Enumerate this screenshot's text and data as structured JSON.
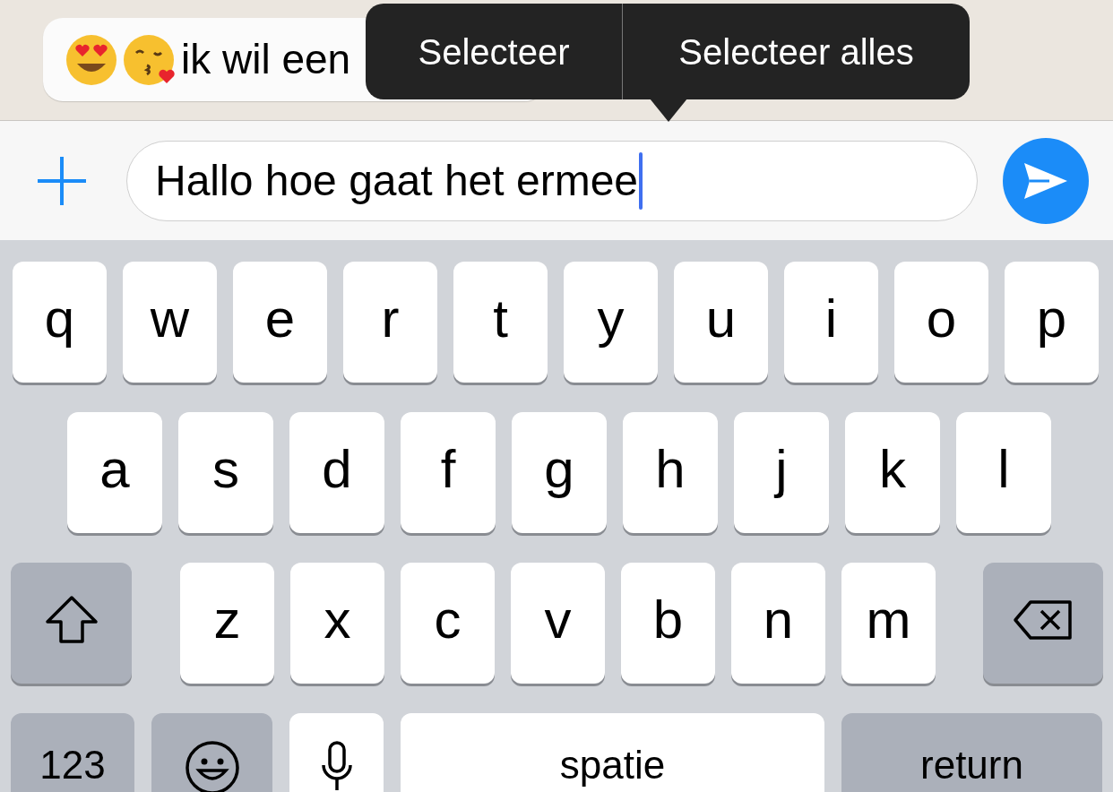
{
  "chat": {
    "bubble": {
      "text": "ik wil een"
    }
  },
  "context_menu": {
    "items": [
      {
        "label": "Selecteer"
      },
      {
        "label": "Selecteer alles"
      }
    ]
  },
  "composer": {
    "value": "Hallo hoe gaat het ermee"
  },
  "keyboard": {
    "rows": [
      [
        {
          "kind": "letter",
          "label": "q"
        },
        {
          "kind": "letter",
          "label": "w"
        },
        {
          "kind": "letter",
          "label": "e"
        },
        {
          "kind": "letter",
          "label": "r"
        },
        {
          "kind": "letter",
          "label": "t"
        },
        {
          "kind": "letter",
          "label": "y"
        },
        {
          "kind": "letter",
          "label": "u"
        },
        {
          "kind": "letter",
          "label": "i"
        },
        {
          "kind": "letter",
          "label": "o"
        },
        {
          "kind": "letter",
          "label": "p"
        }
      ],
      [
        {
          "kind": "letter",
          "label": "a"
        },
        {
          "kind": "letter",
          "label": "s"
        },
        {
          "kind": "letter",
          "label": "d"
        },
        {
          "kind": "letter",
          "label": "f"
        },
        {
          "kind": "letter",
          "label": "g"
        },
        {
          "kind": "letter",
          "label": "h"
        },
        {
          "kind": "letter",
          "label": "j"
        },
        {
          "kind": "letter",
          "label": "k"
        },
        {
          "kind": "letter",
          "label": "l"
        }
      ],
      [
        {
          "kind": "shift"
        },
        {
          "kind": "letter",
          "label": "z"
        },
        {
          "kind": "letter",
          "label": "x"
        },
        {
          "kind": "letter",
          "label": "c"
        },
        {
          "kind": "letter",
          "label": "v"
        },
        {
          "kind": "letter",
          "label": "b"
        },
        {
          "kind": "letter",
          "label": "n"
        },
        {
          "kind": "letter",
          "label": "m"
        },
        {
          "kind": "delete"
        }
      ]
    ],
    "bottom_bar": [
      {
        "kind": "numbers",
        "label": "123"
      },
      {
        "kind": "emoji"
      },
      {
        "kind": "mic"
      },
      {
        "kind": "space",
        "label": "spatie"
      },
      {
        "kind": "return",
        "label": "return"
      }
    ]
  }
}
